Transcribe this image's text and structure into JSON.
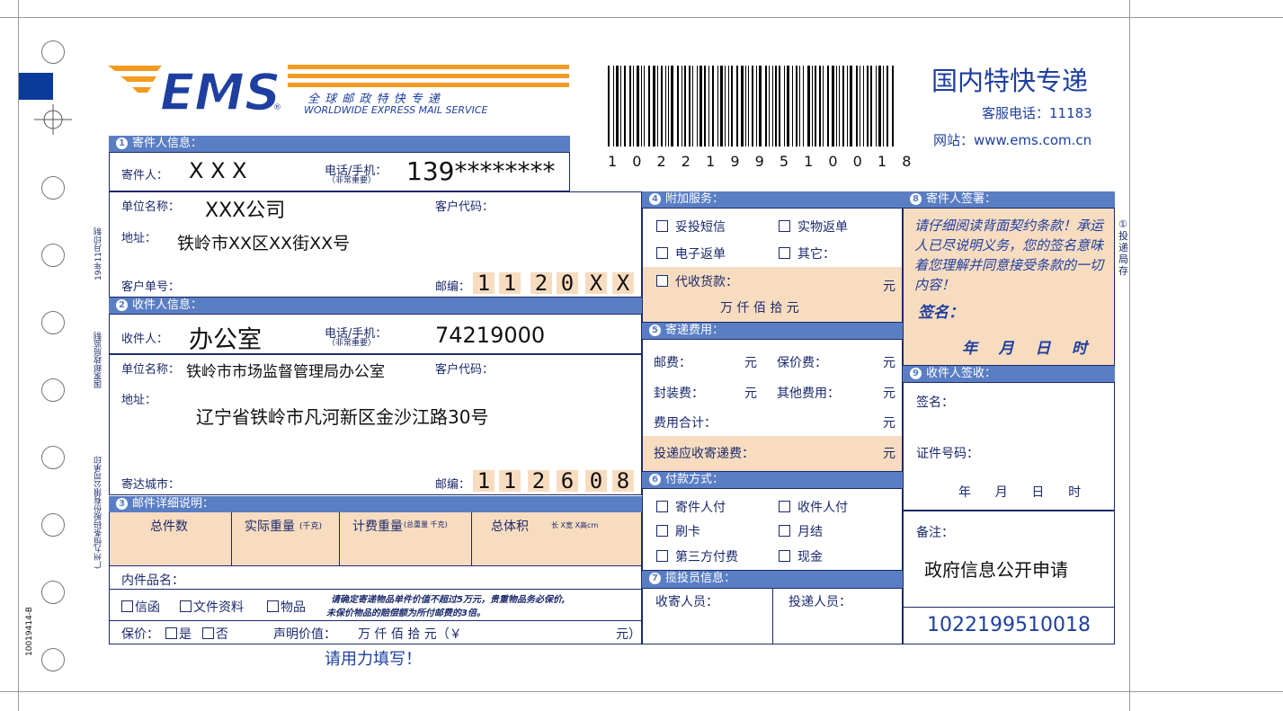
{
  "brand": {
    "logo_text": "EMS",
    "tagline_cn": "全 球 邮 政 特 快 专 递",
    "tagline_en": "WORLDWIDE EXPRESS MAIL SERVICE",
    "registered": "®"
  },
  "header": {
    "title": "国内特快专递",
    "hotline": "客服电话：11183",
    "website": "网站：www.ems.com.cn",
    "barcode_number": "1 0 2 2 1 9 9 5 1 0 0 1 8"
  },
  "margin": {
    "print_date": "19年11月印制",
    "supervisor": "国家邮政局监制",
    "printer": "广州九恒条码股份有限公司承印",
    "form_code": "10019414-B",
    "right_note": "①投递局存"
  },
  "sender": {
    "section": "寄件人信息：",
    "name_label": "寄件人：",
    "name": "X X X",
    "phone_label": "电话/手机：",
    "phone_note": "（非常重要）",
    "phone": "139********",
    "company_label": "单位名称：",
    "company": "XXX公司",
    "customer_code_label": "客户代码：",
    "address_label": "地址：",
    "address": "铁岭市XX区XX街XX号",
    "order_label": "客户单号：",
    "postcode_label": "邮编：",
    "postcode": [
      "1",
      "1",
      "2",
      "0",
      "X",
      "X"
    ]
  },
  "recipient": {
    "section": "收件人信息：",
    "name_label": "收件人：",
    "name": "办公室",
    "phone_label": "电话/手机：",
    "phone_note": "（非常重要）",
    "phone": "74219000",
    "company_label": "单位名称：",
    "company": "铁岭市市场监督管理局办公室",
    "customer_code_label": "客户代码：",
    "address_label": "地址：",
    "address": "辽宁省铁岭市凡河新区金沙江路30号",
    "city_label": "寄达城市：",
    "postcode_label": "邮编：",
    "postcode": [
      "1",
      "1",
      "2",
      "6",
      "0",
      "8"
    ]
  },
  "items": {
    "section": "邮件详细说明：",
    "col_count": "总件数",
    "col_weight": "实际重量",
    "col_weight_unit": "(千克)",
    "col_billed": "计费重量",
    "col_billed_unit": "(总重量 千克)",
    "col_volume": "总体积",
    "col_volume_unit": "长   X宽   X高cm",
    "contents_label": "内件品名：",
    "type_letter": "信函",
    "type_docs": "文件资料",
    "type_goods": "物品",
    "notice_line1": "请确定寄递物品单件价值不超过5万元，贵重物品务必保价,",
    "notice_line2": "未保价物品的赔偿额为所付邮费的3倍。",
    "insure_label": "保价：",
    "insure_yes": "是",
    "insure_no": "否",
    "declared_label": "声明价值：",
    "declared_units": "万    仟    佰    拾    元（￥",
    "declared_end": "元）"
  },
  "fill_hint": "请用力填写！",
  "addon": {
    "section": "附加服务：",
    "sms": "妥投短信",
    "physical_return": "实物返单",
    "e_return": "电子返单",
    "other": "其它：",
    "cod": "代收货款：",
    "yuan": "元",
    "units": "万     仟     佰     拾     元"
  },
  "fees": {
    "section": "寄递费用：",
    "postage": "邮费：",
    "yuan": "元",
    "insurance": "保价费：",
    "packing": "封装费：",
    "other": "其他费用：",
    "total": "费用合计：",
    "collect": "投递应收寄递费："
  },
  "payment": {
    "section": "付款方式：",
    "sender_pays": "寄件人付",
    "recipient_pays": "收件人付",
    "card": "刷卡",
    "monthly": "月结",
    "third_party": "第三方付费",
    "cash": "现金"
  },
  "courier": {
    "section": "揽投员信息：",
    "pickup": "收寄人员：",
    "delivery": "投递人员："
  },
  "sender_sign": {
    "section": "寄件人签署：",
    "notice": "请仔细阅读背面契约条款！承运人已尽说明义务，您的签名意味着您理解并同意接受条款的一切内容！",
    "sign": "签名：",
    "date": "年    月    日    时"
  },
  "recipient_sign": {
    "section": "收件人签收：",
    "sign": "签名：",
    "id": "证件号码：",
    "date": "年      月      日      时"
  },
  "remarks": {
    "label": "备注：",
    "text": "政府信息公开申请",
    "tracking": "1022199510018"
  },
  "colors": {
    "section_bar": "#5a7ec4",
    "ink": "#1b2a6b",
    "peach": "#f8dcc0",
    "ems_orange": "#f39b1f",
    "ems_blue": "#1e3fa0"
  }
}
